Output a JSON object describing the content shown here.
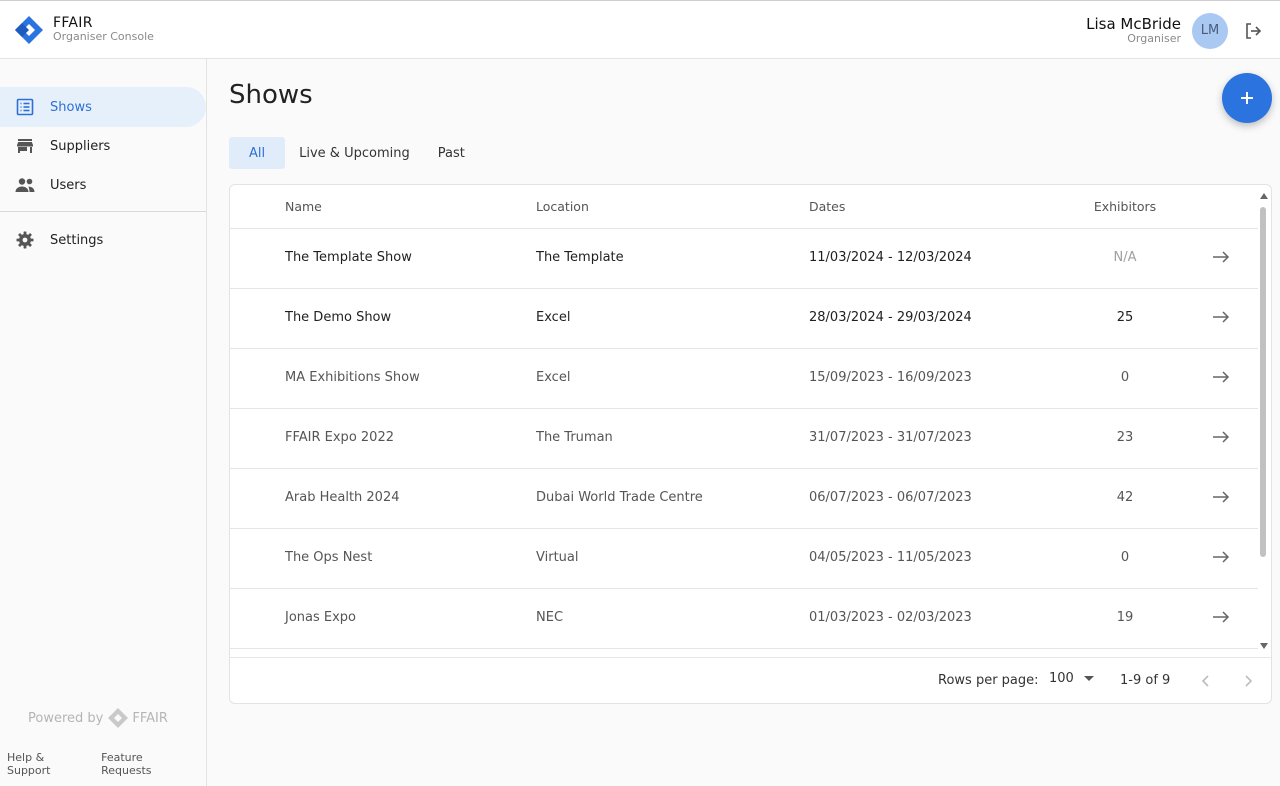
{
  "app": {
    "name": "FFAIR",
    "subtitle": "Organiser Console"
  },
  "user": {
    "name": "Lisa McBride",
    "role": "Organiser",
    "initials": "LM"
  },
  "sidebar": {
    "items": [
      {
        "label": "Shows",
        "icon": "list-icon",
        "active": true
      },
      {
        "label": "Suppliers",
        "icon": "store-icon",
        "active": false
      },
      {
        "label": "Users",
        "icon": "people-icon",
        "active": false
      },
      {
        "label": "Settings",
        "icon": "gear-icon",
        "active": false
      }
    ],
    "powered_by": "Powered by",
    "powered_brand": "FFAIR",
    "help_link": "Help & Support",
    "feature_link": "Feature Requests"
  },
  "page": {
    "title": "Shows"
  },
  "tabs": [
    {
      "label": "All",
      "active": true
    },
    {
      "label": "Live & Upcoming",
      "active": false
    },
    {
      "label": "Past",
      "active": false
    }
  ],
  "table": {
    "columns": [
      "Name",
      "Location",
      "Dates",
      "Exhibitors"
    ],
    "rows": [
      {
        "name": "The Template Show",
        "location": "The Template",
        "dates": "11/03/2024 - 12/03/2024",
        "exhibitors": "N/A"
      },
      {
        "name": "The Demo Show",
        "location": "Excel",
        "dates": "28/03/2024 - 29/03/2024",
        "exhibitors": "25"
      },
      {
        "name": "MA Exhibitions Show",
        "location": "Excel",
        "dates": "15/09/2023 - 16/09/2023",
        "exhibitors": "0"
      },
      {
        "name": "FFAIR Expo 2022",
        "location": "The Truman",
        "dates": "31/07/2023 - 31/07/2023",
        "exhibitors": "23"
      },
      {
        "name": "Arab Health 2024",
        "location": "Dubai World Trade Centre",
        "dates": "06/07/2023 - 06/07/2023",
        "exhibitors": "42"
      },
      {
        "name": "The Ops Nest",
        "location": "Virtual",
        "dates": "04/05/2023 - 11/05/2023",
        "exhibitors": "0"
      },
      {
        "name": "Jonas Expo",
        "location": "NEC",
        "dates": "01/03/2023 - 02/03/2023",
        "exhibitors": "19"
      }
    ]
  },
  "pagination": {
    "rows_per_page_label": "Rows per page:",
    "rows_per_page": "100",
    "range": "1-9 of 9"
  },
  "colors": {
    "accent": "#2b74e0",
    "active_nav_bg": "#e6f0fb",
    "avatar_bg": "#a9c8f2"
  }
}
